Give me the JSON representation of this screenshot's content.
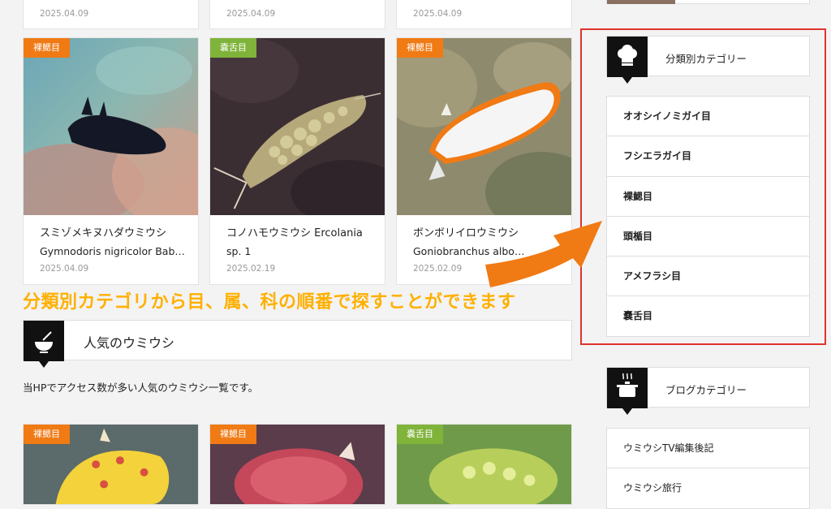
{
  "top_row_dates": [
    "2025.04.09",
    "2025.04.09",
    "2025.04.09"
  ],
  "cards_row1": [
    {
      "badge": "裸鰓目",
      "badge_color": "#f07a14",
      "title_line1": "スミゾメキヌハダウミウシ",
      "title_line2": "Gymnodoris nigricolor Bab…",
      "date": "2025.04.09"
    },
    {
      "badge": "嚢舌目",
      "badge_color": "#7fb33a",
      "title_line1": "コノハモウミウシ Ercolania",
      "title_line2": "sp. 1",
      "date": "2025.02.19"
    },
    {
      "badge": "裸鰓目",
      "badge_color": "#f07a14",
      "title_line1": "ボンボリイロウミウシ",
      "title_line2": "Goniobranchus albo…",
      "date": "2025.02.09"
    }
  ],
  "annotation_banner": "分類別カテゴリから目、属、科の順番で探すことができます",
  "popular": {
    "heading": "人気のウミウシ",
    "icon": "bowl-icon",
    "description": "当HPでアクセス数が多い人気のウミウシ一覧です。"
  },
  "cards_row2": [
    {
      "badge": "裸鰓目",
      "badge_color": "#f07a14"
    },
    {
      "badge": "裸鰓目",
      "badge_color": "#f07a14"
    },
    {
      "badge": "嚢舌目",
      "badge_color": "#7fb33a"
    }
  ],
  "sidebar": {
    "category_heading": "分類別カテゴリー",
    "category_icon": "chef-hat-icon",
    "categories": [
      "オオシイノミガイ目",
      "フシエラガイ目",
      "裸鰓目",
      "頭楯目",
      "アメフラシ目",
      "嚢舌目"
    ],
    "blog_heading": "ブログカテゴリー",
    "blog_icon": "pot-icon",
    "blog_items": [
      "ウミウシTV編集後記",
      "ウミウシ旅行"
    ]
  },
  "colors": {
    "highlight_box": "#e0332e",
    "arrow": "#f07a14",
    "banner_text": "#ffb000"
  }
}
